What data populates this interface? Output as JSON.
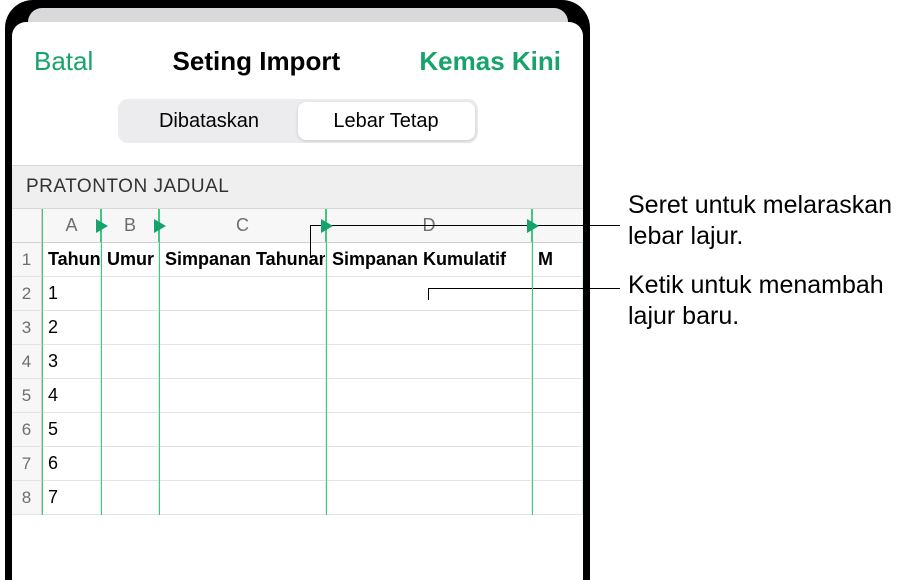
{
  "header": {
    "cancel": "Batal",
    "title": "Seting Import",
    "update": "Kemas Kini"
  },
  "segmented": {
    "delimited": "Dibataskan",
    "fixed_width": "Lebar Tetap"
  },
  "section_header": "PRATONTON JADUAL",
  "columns": {
    "a": "A",
    "b": "B",
    "c": "C",
    "d": "D"
  },
  "row1": {
    "a": "Tahun",
    "b": "Umur",
    "c": "Simpanan Tahunan",
    "d": "Simpanan Kumulatif",
    "e": "M"
  },
  "rownums": {
    "r1": "1",
    "r2": "2",
    "r3": "3",
    "r4": "4",
    "r5": "5",
    "r6": "6",
    "r7": "7",
    "r8": "8"
  },
  "vals": {
    "r2": "1",
    "r3": "2",
    "r4": "3",
    "r5": "4",
    "r6": "5",
    "r7": "6",
    "r8": "7"
  },
  "annotations": {
    "drag": "Seret untuk melaraskan lebar lajur.",
    "tap": "Ketik untuk menambah lajur baru."
  }
}
